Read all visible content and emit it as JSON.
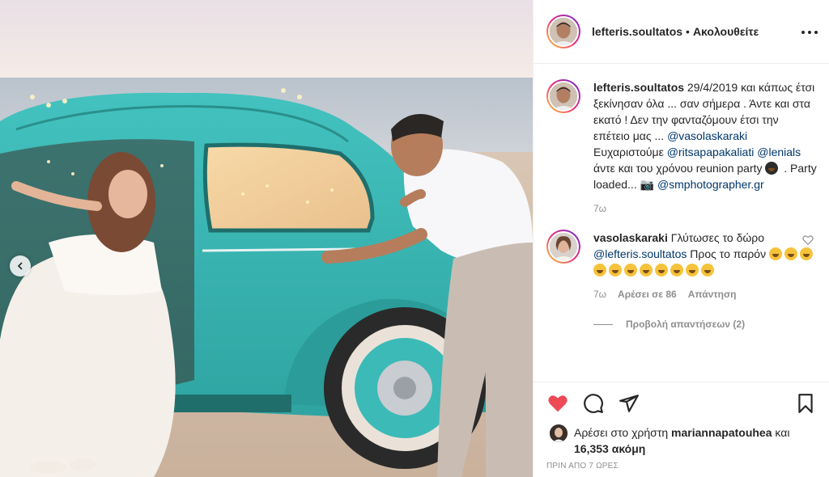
{
  "post": {
    "author": "lefteris.soultatos",
    "separator": "•",
    "follow_label": "Ακολουθείτε",
    "caption": {
      "user": "lefteris.soultatos",
      "text_1": " 29/4/2019 και κάπως έτσι ξεκίνησαν όλα ... σαν σήμερα . Άντε και στα εκατό ! Δεν την φανταζόμουν έτσι την επέτειο μας ... ",
      "mention_1": "@vasolaskaraki",
      "text_2": " Ευχαριστούμε ",
      "mention_2": "@ritsapapakaliati",
      "text_3": " ",
      "mention_3": "@lenials",
      "text_4": " άντε και του χρόνου reunion party ",
      "text_5": " . Party loaded... ",
      "camera_glyph": "📷",
      "mention_4": "@smphotographer.gr",
      "time": "7ω"
    },
    "comment": {
      "user": "vasolaskaraki",
      "text_1": " Γλύτωσες το δώρο ",
      "mention": "@lefteris.soultatos",
      "text_2": " Προς το παρόν ",
      "time": "7ω",
      "likes": "Αρέσει σε 86",
      "reply": "Απάντηση",
      "view_replies": "Προβολή απαντήσεων (2)"
    },
    "likes": {
      "prefix": "Αρέσει στο χρήστη ",
      "user": "mariannapatouhea",
      "middle": " και ",
      "count": "16,353 ακόμη"
    },
    "posted_ago": "ΠΡΙΝ ΑΠΟ 7 ΩΡΕΣ"
  },
  "colors": {
    "like_red": "#ed4956",
    "mention_blue": "#00376b",
    "muted_gray": "#8e8e8e",
    "car_turquoise": "#35b5b2"
  }
}
